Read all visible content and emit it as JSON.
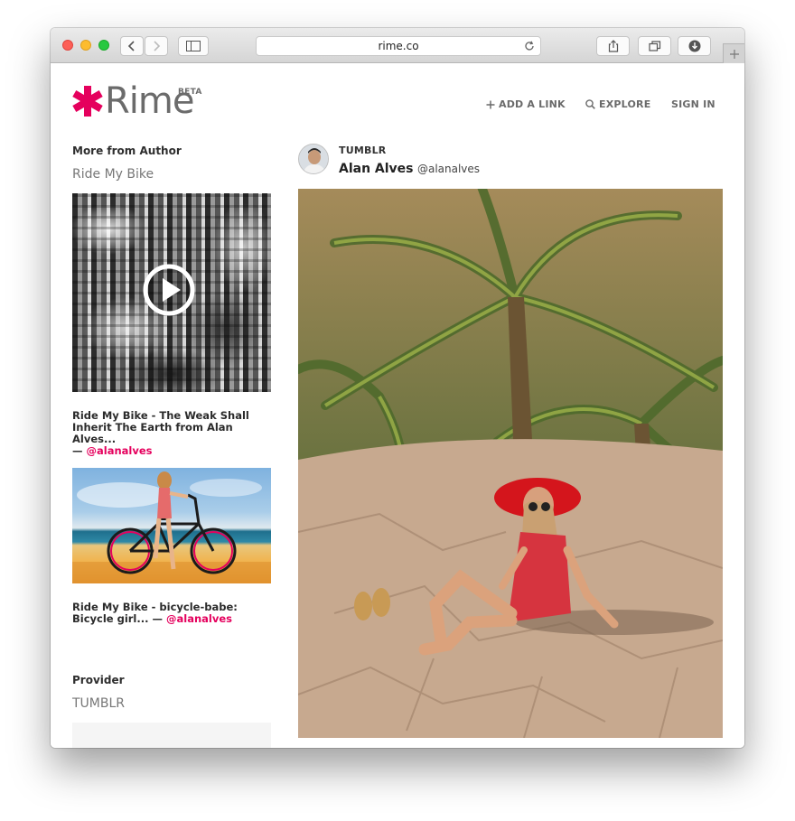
{
  "browser": {
    "url": "rime.co"
  },
  "header": {
    "logo_text": "Rime",
    "logo_badge": "BETA",
    "logo_color": "#e5005d",
    "nav": [
      {
        "label": "ADD A LINK",
        "icon": "plus-icon"
      },
      {
        "label": "EXPLORE",
        "icon": "search-icon"
      },
      {
        "label": "SIGN IN"
      }
    ]
  },
  "sidebar": {
    "more_heading": "More from Author",
    "more_subheading": "Ride My Bike",
    "cards": [
      {
        "title": "Ride My Bike - The Weak Shall Inherit The Earth from Alan Alves...",
        "separator": "—",
        "handle": "@alanalves",
        "thumb_icon": "play-icon"
      },
      {
        "title": "Ride My Bike - bicycle-babe: Bicycle girl...",
        "separator": "—",
        "handle": "@alanalves"
      }
    ],
    "provider_heading": "Provider",
    "provider_name": "TUMBLR"
  },
  "post": {
    "provider": "TUMBLR",
    "author_name": "Alan Alves",
    "author_handle": "@alanalves"
  },
  "colors": {
    "accent": "#e5005d",
    "nav_text": "#6a6a6a"
  }
}
